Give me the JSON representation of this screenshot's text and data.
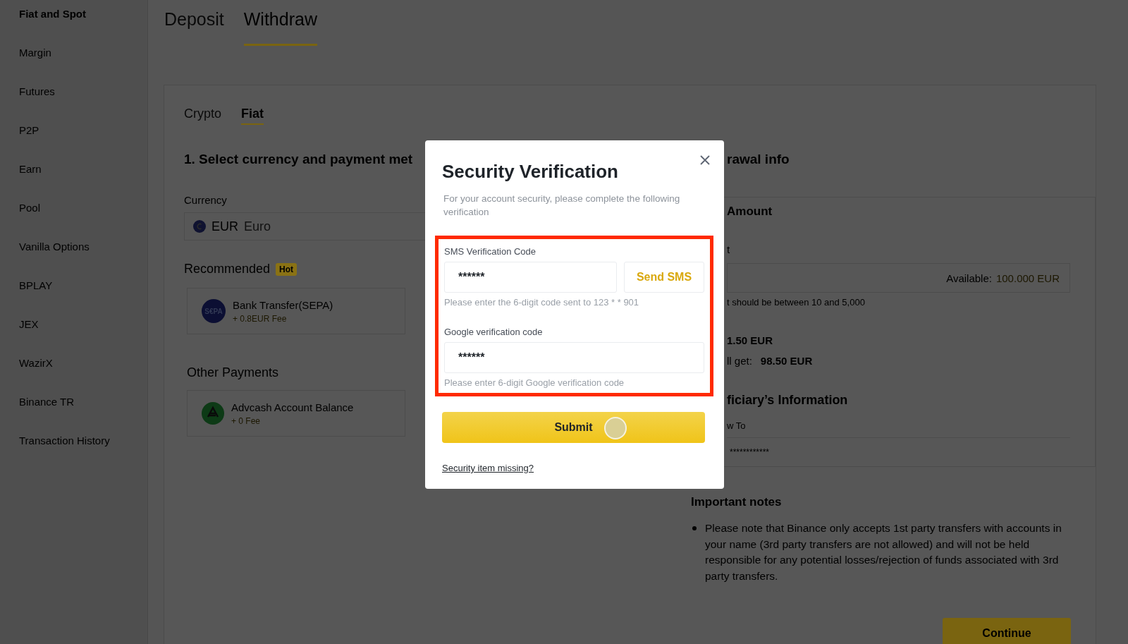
{
  "sidebar": {
    "items": [
      {
        "label": "Fiat and Spot",
        "selected": true
      },
      {
        "label": "Margin",
        "selected": false
      },
      {
        "label": "Futures",
        "selected": false
      },
      {
        "label": "P2P",
        "selected": false
      },
      {
        "label": "Earn",
        "selected": false
      },
      {
        "label": "Pool",
        "selected": false
      },
      {
        "label": "Vanilla Options",
        "selected": false
      },
      {
        "label": "BPLAY",
        "selected": false
      },
      {
        "label": "JEX",
        "selected": false
      },
      {
        "label": "WazirX",
        "selected": false
      },
      {
        "label": "Binance TR",
        "selected": false
      },
      {
        "label": "Transaction History",
        "selected": false
      }
    ]
  },
  "top_tabs": [
    {
      "label": "Deposit",
      "selected": false
    },
    {
      "label": "Withdraw",
      "selected": true
    }
  ],
  "sub_tabs": [
    {
      "label": "Crypto",
      "selected": false
    },
    {
      "label": "Fiat",
      "selected": true
    }
  ],
  "payment_section": {
    "heading": "1. Select currency and payment met",
    "currency_label": "Currency",
    "currency_code": "EUR",
    "currency_name": "Euro",
    "recommended_title": "Recommended",
    "recommended_badge": "Hot",
    "recommended": [
      {
        "kind": "sepa",
        "logo_text": "S€PA",
        "name": "Bank Transfer(SEPA)",
        "fee": "+ 0.8EUR Fee"
      }
    ],
    "other_title": "Other Payments",
    "other": [
      {
        "kind": "advcash",
        "name": "Advcash Account Balance",
        "fee": "+ 0 Fee"
      }
    ]
  },
  "withdrawal_info": {
    "heading": "rawal info",
    "amount_heading": "Amount",
    "amount_label": "t",
    "available_label": "Available:",
    "available_value": "100.000 EUR",
    "amount_hint": "t should be between 10 and 5,000",
    "fee_value": "1.50 EUR",
    "receive_label": "ll get:",
    "receive_value": "98.50 EUR",
    "beneficiary_heading": "ficiary’s Information",
    "withdraw_to_label": "w To",
    "account_value": "************",
    "notes_heading": "Important notes",
    "notes": [
      "Please note that Binance only accepts 1st party transfers with accounts in your name (3rd party transfers are not allowed) and will not be held responsible for any potential losses/rejection of funds associated with 3rd party transfers."
    ],
    "continue_button": "Continue"
  },
  "modal": {
    "title": "Security Verification",
    "description": "For your account security, please complete the following verification",
    "highlighted": true,
    "fields": [
      {
        "kind": "with_button",
        "label": "SMS Verification Code",
        "value": "******",
        "button": "Send SMS",
        "hint": "Please enter the 6-digit code sent to 123 * * 901"
      },
      {
        "kind": "plain",
        "label": "Google verification code",
        "value": "******",
        "hint": "Please enter 6-digit Google verification code"
      }
    ],
    "submit_button": "Submit",
    "link": "Security item missing?"
  }
}
